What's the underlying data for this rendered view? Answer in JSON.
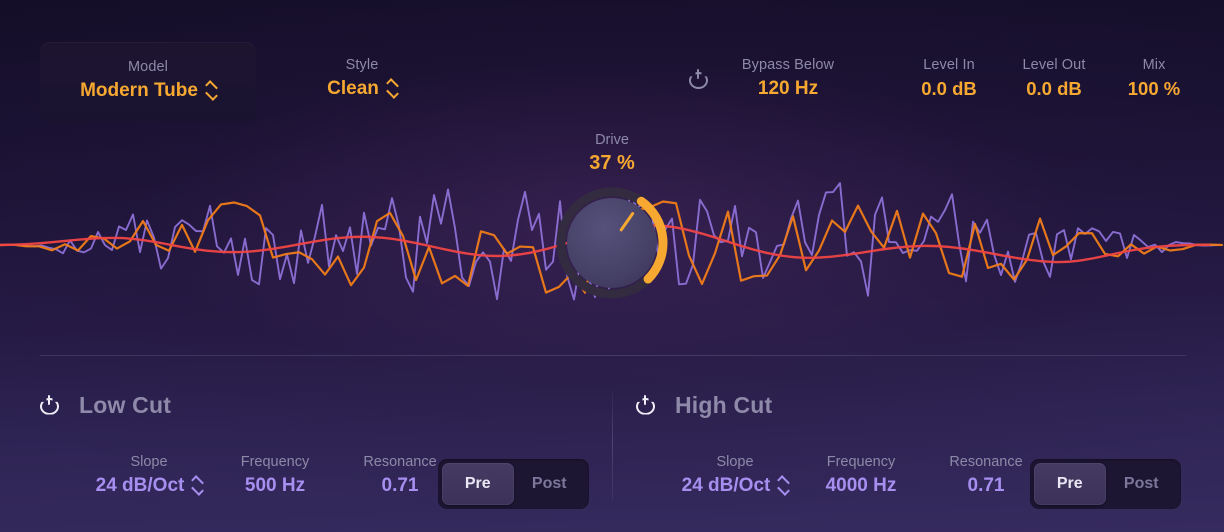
{
  "header": {
    "model": {
      "label": "Model",
      "value": "Modern Tube",
      "icon": "stepper-icon"
    },
    "style": {
      "label": "Style",
      "value": "Clean",
      "icon": "stepper-icon"
    },
    "power": {
      "icon": "power-icon"
    },
    "bypass_below": {
      "label": "Bypass Below",
      "value": "120 Hz"
    },
    "level_in": {
      "label": "Level In",
      "value": "0.0 dB"
    },
    "level_out": {
      "label": "Level Out",
      "value": "0.0 dB"
    },
    "mix": {
      "label": "Mix",
      "value": "100 %"
    }
  },
  "drive": {
    "label": "Drive",
    "value": "37 %",
    "percent": 37
  },
  "waveform": {
    "colors": {
      "high": "#9a7ae8",
      "mid": "#f07c18",
      "low": "#ef4444"
    }
  },
  "low_cut": {
    "title": "Low Cut",
    "power_icon": "power-icon",
    "slope": {
      "label": "Slope",
      "value": "24 dB/Oct",
      "icon": "stepper-icon"
    },
    "frequency": {
      "label": "Frequency",
      "value": "500 Hz"
    },
    "resonance": {
      "label": "Resonance",
      "value": "0.71"
    },
    "position": {
      "options": [
        "Pre",
        "Post"
      ],
      "selected": "Pre"
    }
  },
  "high_cut": {
    "title": "High Cut",
    "power_icon": "power-icon",
    "slope": {
      "label": "Slope",
      "value": "24 dB/Oct",
      "icon": "stepper-icon"
    },
    "frequency": {
      "label": "Frequency",
      "value": "4000 Hz"
    },
    "resonance": {
      "label": "Resonance",
      "value": "0.71"
    },
    "position": {
      "options": [
        "Pre",
        "Post"
      ],
      "selected": "Pre"
    }
  },
  "theme": {
    "accent": "#f6a831",
    "label": "#8d89a8",
    "filter_value": "#a78ff0"
  }
}
